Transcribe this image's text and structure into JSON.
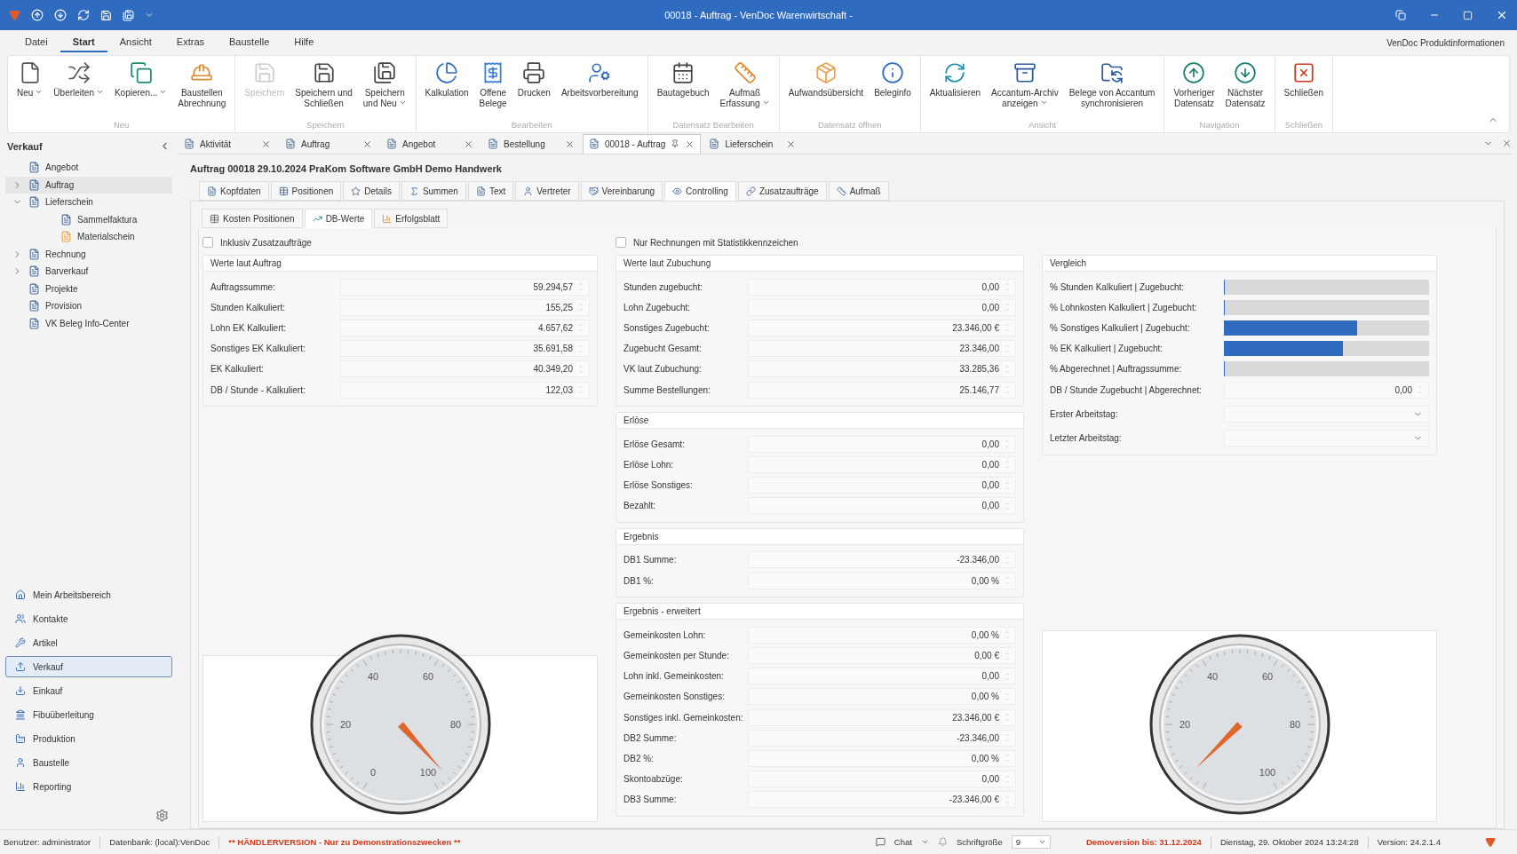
{
  "window": {
    "title": "00018 - Auftrag - VenDoc Warenwirtschaft -"
  },
  "menu": {
    "items": [
      {
        "label": "Datei",
        "selected": false
      },
      {
        "label": "Start",
        "selected": true
      },
      {
        "label": "Ansicht",
        "selected": false
      },
      {
        "label": "Extras",
        "selected": false
      },
      {
        "label": "Baustelle",
        "selected": false
      },
      {
        "label": "Hilfe",
        "selected": false
      }
    ],
    "info_link": "VenDoc Produktinformationen"
  },
  "ribbon": [
    {
      "label": "Neu",
      "buttons": [
        {
          "label": "Neu",
          "dropdown": true,
          "disabled": false
        },
        {
          "label": "Überleiten",
          "dropdown": true,
          "disabled": false
        },
        {
          "label": "Kopieren...",
          "dropdown": true,
          "disabled": false
        },
        {
          "label": "Baustellen\nAbrechnung",
          "dropdown": false,
          "disabled": false
        }
      ]
    },
    {
      "label": "Speichern",
      "buttons": [
        {
          "label": "Speichern",
          "dropdown": false,
          "disabled": true
        },
        {
          "label": "Speichern und\nSchließen",
          "dropdown": false,
          "disabled": false
        },
        {
          "label": "Speichern\nund Neu",
          "dropdown": true,
          "disabled": false
        }
      ]
    },
    {
      "label": "Bearbeiten",
      "buttons": [
        {
          "label": "Kalkulation",
          "dropdown": false,
          "disabled": false
        },
        {
          "label": "Offene\nBelege",
          "dropdown": false,
          "disabled": false
        },
        {
          "label": "Drucken",
          "dropdown": false,
          "disabled": false
        },
        {
          "label": "Arbeitsvorbereitung",
          "dropdown": false,
          "disabled": false
        }
      ]
    },
    {
      "label": "Datensatz Bearbeiten",
      "buttons": [
        {
          "label": "Bautagebuch",
          "dropdown": false,
          "disabled": false
        },
        {
          "label": "Aufmaß\nErfassung",
          "dropdown": true,
          "disabled": false
        }
      ]
    },
    {
      "label": "Datensatz öffnen",
      "buttons": [
        {
          "label": "Aufwandsübersicht",
          "dropdown": false,
          "disabled": false
        },
        {
          "label": "Beleginfo",
          "dropdown": false,
          "disabled": false
        }
      ]
    },
    {
      "label": "Ansicht",
      "buttons": [
        {
          "label": "Aktualisieren",
          "dropdown": false,
          "disabled": false
        },
        {
          "label": "Accantum-Archiv\nanzeigen",
          "dropdown": true,
          "disabled": false
        },
        {
          "label": "Belege von Accantum\nsynchronisieren",
          "dropdown": false,
          "disabled": false
        }
      ]
    },
    {
      "label": "Navigation",
      "buttons": [
        {
          "label": "Vorheriger\nDatensatz",
          "dropdown": false,
          "disabled": false
        },
        {
          "label": "Nächster\nDatensatz",
          "dropdown": false,
          "disabled": false
        }
      ]
    },
    {
      "label": "Schließen",
      "buttons": [
        {
          "label": "Schließen",
          "dropdown": false,
          "disabled": false
        }
      ]
    }
  ],
  "sidebar": {
    "title": "Verkauf",
    "tree": [
      {
        "label": "Angebot",
        "selected": false
      },
      {
        "label": "Auftrag",
        "selected": true,
        "expanded": false
      },
      {
        "label": "Lieferschein",
        "selected": false,
        "expanded": true,
        "children": [
          {
            "label": "Sammelfaktura",
            "selected": false
          },
          {
            "label": "Materialschein",
            "selected": false
          }
        ]
      },
      {
        "label": "Rechnung",
        "selected": false,
        "expanded": false
      },
      {
        "label": "Barverkauf",
        "selected": false,
        "expanded": false
      },
      {
        "label": "Projekte",
        "selected": false
      },
      {
        "label": "Provision",
        "selected": false
      },
      {
        "label": "VK Beleg Info-Center",
        "selected": false
      }
    ],
    "nav": [
      {
        "label": "Mein Arbeitsbereich",
        "selected": false
      },
      {
        "label": "Kontakte",
        "selected": false
      },
      {
        "label": "Artikel",
        "selected": false
      },
      {
        "label": "Verkauf",
        "selected": true
      },
      {
        "label": "Einkauf",
        "selected": false
      },
      {
        "label": "Fibuüberleitung",
        "selected": false
      },
      {
        "label": "Produktion",
        "selected": false
      },
      {
        "label": "Baustelle",
        "selected": false
      },
      {
        "label": "Reporting",
        "selected": false
      }
    ]
  },
  "doc_tabs": [
    {
      "label": "Aktivität",
      "selected": false,
      "pinned": false
    },
    {
      "label": "Auftrag",
      "selected": false,
      "pinned": false
    },
    {
      "label": "Angebot",
      "selected": false,
      "pinned": false
    },
    {
      "label": "Bestellung",
      "selected": false,
      "pinned": false
    },
    {
      "label": "00018 - Auftrag",
      "selected": true,
      "pinned": true
    },
    {
      "label": "Lieferschein",
      "selected": false,
      "pinned": false
    }
  ],
  "heading": "Auftrag 00018 29.10.2024 PraKom Software GmbH Demo Handwerk",
  "tabs": [
    {
      "label": "Kopfdaten",
      "selected": false
    },
    {
      "label": "Positionen",
      "selected": false
    },
    {
      "label": "Details",
      "selected": false
    },
    {
      "label": "Summen",
      "selected": false
    },
    {
      "label": "Text",
      "selected": false
    },
    {
      "label": "Vertreter",
      "selected": false
    },
    {
      "label": "Vereinbarung",
      "selected": false
    },
    {
      "label": "Controlling",
      "selected": true
    },
    {
      "label": "Zusatzaufträge",
      "selected": false
    },
    {
      "label": "Aufmaß",
      "selected": false
    }
  ],
  "subtabs": [
    {
      "label": "Kosten Positionen",
      "selected": false
    },
    {
      "label": "DB-Werte",
      "selected": true
    },
    {
      "label": "Erfolgsblatt",
      "selected": false
    }
  ],
  "left": {
    "checkbox": {
      "label": "Inklusiv Zusatzaufträge",
      "checked": false
    },
    "groups": [
      {
        "title": "Werte laut Auftrag",
        "fields": [
          {
            "label": "Auftragssumme:",
            "value": "59.294,57"
          },
          {
            "label": "Stunden Kalkuliert:",
            "value": "155,25"
          },
          {
            "label": "Lohn EK Kalkuliert:",
            "value": "4.657,62"
          },
          {
            "label": "Sonstiges EK Kalkuliert:",
            "value": "35.691,58"
          },
          {
            "label": "EK Kalkuliert:",
            "value": "40.349,20"
          },
          {
            "label": "DB / Stunde - Kalkuliert:",
            "value": "122,03"
          }
        ]
      }
    ],
    "gauge": {
      "labels": [
        "0",
        "20",
        "40",
        "60",
        "80",
        "100"
      ]
    }
  },
  "middle": {
    "checkbox": {
      "label": "Nur Rechnungen mit Statistikkennzeichen",
      "checked": false
    },
    "groups": [
      {
        "title": "Werte laut Zubuchung",
        "fields": [
          {
            "label": "Stunden zugebucht:",
            "value": "0,00"
          },
          {
            "label": "Lohn Zugebucht:",
            "value": "0,00"
          },
          {
            "label": "Sonstiges Zugebucht:",
            "value": "23.346,00 €"
          },
          {
            "label": "Zugebucht Gesamt:",
            "value": "23.346,00"
          },
          {
            "label": "VK laut Zubuchung:",
            "value": "33.285,36"
          },
          {
            "label": "Summe Bestellungen:",
            "value": "25.146,77"
          }
        ]
      },
      {
        "title": "Erlöse",
        "fields": [
          {
            "label": "Erlöse Gesamt:",
            "value": "0,00"
          },
          {
            "label": "Erlöse Lohn:",
            "value": "0,00"
          },
          {
            "label": "Erlöse Sonstiges:",
            "value": "0,00"
          },
          {
            "label": "Bezahlt:",
            "value": "0,00"
          }
        ]
      },
      {
        "title": "Ergebnis",
        "fields": [
          {
            "label": "DB1 Summe:",
            "value": "-23.346,00"
          },
          {
            "label": "DB1 %:",
            "value": "0,00 %"
          }
        ]
      },
      {
        "title": "Ergebnis - erweitert",
        "fields": [
          {
            "label": "Gemeinkosten Lohn:",
            "value": "0,00 %"
          },
          {
            "label": "Gemeinkosten per Stunde:",
            "value": "0,00 €"
          },
          {
            "label": "Lohn inkl. Gemeinkosten:",
            "value": "0,00"
          },
          {
            "label": "Gemeinkosten Sonstiges:",
            "value": "0,00 %"
          },
          {
            "label": "Sonstiges inkl. Gemeinkosten:",
            "value": "23.346,00 €"
          },
          {
            "label": "DB2 Summe:",
            "value": "-23.346,00"
          },
          {
            "label": "DB2 %:",
            "value": "0,00 %"
          },
          {
            "label": "Skontoabzüge:",
            "value": "0,00"
          },
          {
            "label": "DB3 Summe:",
            "value": "-23.346,00 €"
          }
        ]
      }
    ]
  },
  "right": {
    "group": {
      "title": "Vergleich",
      "rows": [
        {
          "kind": "bar",
          "label": "% Stunden Kalkuliert | Zugebucht:",
          "level": 0
        },
        {
          "kind": "bar",
          "label": "% Lohnkosten Kalkuliert | Zugebucht:",
          "level": 0
        },
        {
          "kind": "bar",
          "label": "% Sonstiges Kalkuliert | Zugebucht:",
          "level": 0.65
        },
        {
          "kind": "bar",
          "label": "%  EK Kalkuliert | Zugebucht:",
          "level": 0.58
        },
        {
          "kind": "bar",
          "label": "% Abgerechnet | Auftragssumme:",
          "level": 0
        },
        {
          "kind": "number",
          "label": "DB / Stunde Zugebucht | Abgerechnet:",
          "value": "0,00"
        },
        {
          "kind": "dropdown",
          "label": "Erster Arbeitstag:"
        },
        {
          "kind": "dropdown",
          "label": "Letzter Arbeitstag:"
        }
      ]
    },
    "gauge": {
      "labels": [
        "20",
        "40",
        "60",
        "80",
        "100"
      ]
    }
  },
  "status_bar": {
    "user": "Benutzer: administrator",
    "database": "Datenbank: (local):VenDoc",
    "notice": "** HÄNDLERVERSION - Nur zu Demonstrationszwecken **",
    "chat": "Chat",
    "font_size_label": "Schriftgröße",
    "font_size": "9",
    "demo": "Demoversion bis: 31.12.2024",
    "datetime": "Dienstag, 29. Oktober 2024 13:24:28",
    "version": "Version: 24.2.1.4"
  }
}
